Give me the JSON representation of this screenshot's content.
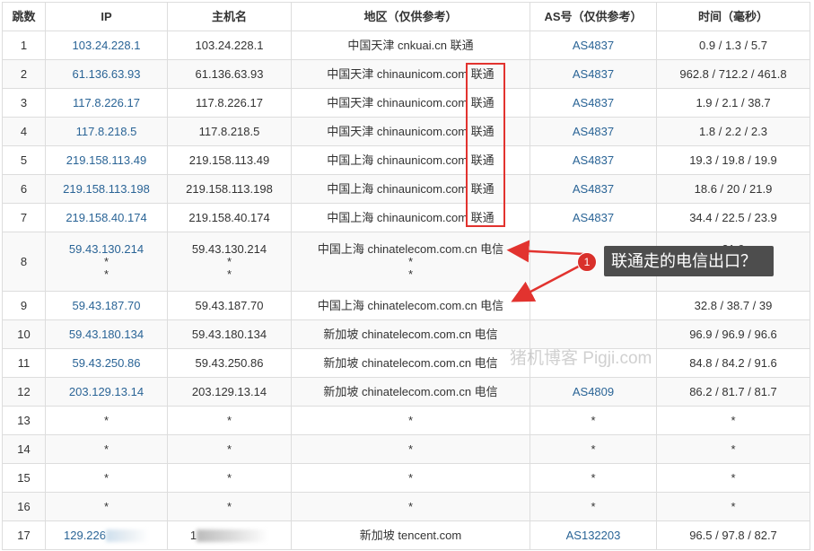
{
  "headers": [
    "跳数",
    "IP",
    "主机名",
    "地区（仅供参考）",
    "AS号（仅供参考）",
    "时间（毫秒）"
  ],
  "rows": [
    {
      "hop": "1",
      "ip": "103.24.228.1",
      "host": "103.24.228.1",
      "region": "中国天津 cnkuai.cn 联通",
      "as": "AS4837",
      "time": "0.9 / 1.3 / 5.7"
    },
    {
      "hop": "2",
      "ip": "61.136.63.93",
      "host": "61.136.63.93",
      "region": "中国天津 chinaunicom.com 联通",
      "as": "AS4837",
      "time": "962.8 / 712.2 / 461.8"
    },
    {
      "hop": "3",
      "ip": "117.8.226.17",
      "host": "117.8.226.17",
      "region": "中国天津 chinaunicom.com 联通",
      "as": "AS4837",
      "time": "1.9 / 2.1 / 38.7"
    },
    {
      "hop": "4",
      "ip": "117.8.218.5",
      "host": "117.8.218.5",
      "region": "中国天津 chinaunicom.com 联通",
      "as": "AS4837",
      "time": "1.8 / 2.2 / 2.3"
    },
    {
      "hop": "5",
      "ip": "219.158.113.49",
      "host": "219.158.113.49",
      "region": "中国上海 chinaunicom.com 联通",
      "as": "AS4837",
      "time": "19.3 / 19.8 / 19.9"
    },
    {
      "hop": "6",
      "ip": "219.158.113.198",
      "host": "219.158.113.198",
      "region": "中国上海 chinaunicom.com 联通",
      "as": "AS4837",
      "time": "18.6 / 20 / 21.9"
    },
    {
      "hop": "7",
      "ip": "219.158.40.174",
      "host": "219.158.40.174",
      "region": "中国上海 chinaunicom.com 联通",
      "as": "AS4837",
      "time": "34.4 / 22.5 / 23.9"
    },
    {
      "hop": "8",
      "ip": "59.43.130.214",
      "host": "59.43.130.214",
      "region": "中国上海 chinatelecom.com.cn 电信",
      "as": "",
      "time": "21.9",
      "extra_lines": [
        "*",
        "*"
      ],
      "as_extra": "*"
    },
    {
      "hop": "9",
      "ip": "59.43.187.70",
      "host": "59.43.187.70",
      "region": "中国上海 chinatelecom.com.cn 电信",
      "as": "",
      "time": "32.8 / 38.7 / 39"
    },
    {
      "hop": "10",
      "ip": "59.43.180.134",
      "host": "59.43.180.134",
      "region": "新加坡 chinatelecom.com.cn 电信",
      "as": "",
      "time": "96.9 / 96.9 / 96.6"
    },
    {
      "hop": "11",
      "ip": "59.43.250.86",
      "host": "59.43.250.86",
      "region": "新加坡 chinatelecom.com.cn 电信",
      "as": "",
      "time": "84.8 / 84.2 / 91.6"
    },
    {
      "hop": "12",
      "ip": "203.129.13.14",
      "host": "203.129.13.14",
      "region": "新加坡 chinatelecom.com.cn 电信",
      "as": "AS4809",
      "time": "86.2 / 81.7 / 81.7"
    },
    {
      "hop": "13",
      "ip": "*",
      "host": "*",
      "region": "*",
      "as": "*",
      "time": "*"
    },
    {
      "hop": "14",
      "ip": "*",
      "host": "*",
      "region": "*",
      "as": "*",
      "time": "*"
    },
    {
      "hop": "15",
      "ip": "*",
      "host": "*",
      "region": "*",
      "as": "*",
      "time": "*"
    },
    {
      "hop": "16",
      "ip": "*",
      "host": "*",
      "region": "*",
      "as": "*",
      "time": "*"
    },
    {
      "hop": "17",
      "ip": "129.226",
      "host": "1",
      "region": "新加坡 tencent.com",
      "as": "AS132203",
      "time": "96.5 / 97.8 / 82.7"
    }
  ],
  "annotation": {
    "badge": "1",
    "text": "联通走的电信出口？",
    "accent_color": "#e2332f"
  },
  "watermark": "猪机博客 Pigji.com"
}
